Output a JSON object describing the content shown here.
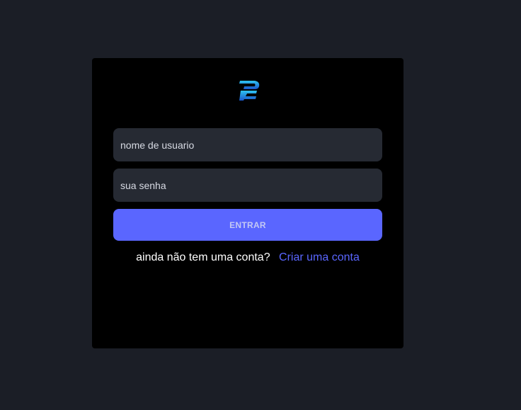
{
  "login": {
    "logo_icon": "stylized-p-logo-icon",
    "username_placeholder": "nome de usuario",
    "password_placeholder": "sua senha",
    "submit_label": "ENTRAR",
    "signup_prompt": "ainda não tem uma conta?",
    "signup_link": "Criar uma conta"
  },
  "colors": {
    "page_background": "#1b1e26",
    "card_background": "#000000",
    "input_background": "#262a33",
    "accent": "#5a66ff",
    "logo_light": "#2ec4f1",
    "logo_dark": "#1a55c8"
  }
}
